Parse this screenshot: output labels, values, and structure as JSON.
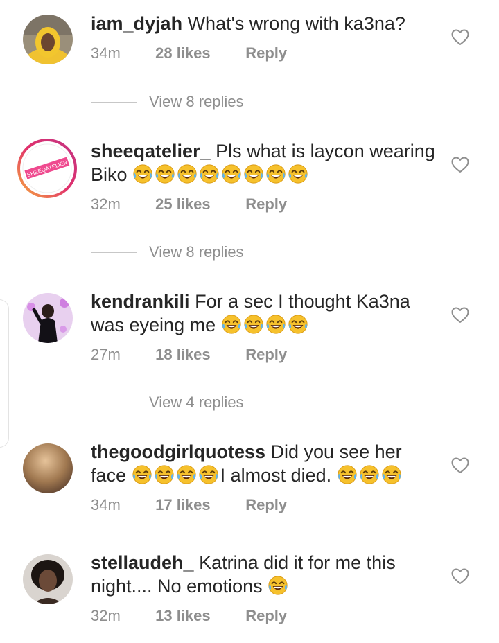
{
  "comments": [
    {
      "username": "iam_dyjah",
      "text": "What's wrong with ka3na?",
      "time": "34m",
      "likes": "28 likes",
      "reply": "Reply",
      "view_replies": "View 8 replies"
    },
    {
      "username": "sheeqatelier_",
      "text": "Pls what is laycon wearing Biko",
      "emoji_count": 8,
      "time": "32m",
      "likes": "25 likes",
      "reply": "Reply",
      "view_replies": "View 8 replies",
      "avatar_logo_text": "SHEEQATELIER"
    },
    {
      "username": "kendrankili",
      "text": "For a sec I thought Ka3na was eyeing me",
      "emoji_count": 4,
      "time": "27m",
      "likes": "18 likes",
      "reply": "Reply",
      "view_replies": "View 4 replies"
    },
    {
      "username": "thegoodgirlquotess",
      "text_a": "Did you see her face",
      "emoji_count_a": 4,
      "text_b": "I almost died.",
      "emoji_count_b": 3,
      "time": "34m",
      "likes": "17 likes",
      "reply": "Reply"
    },
    {
      "username": "stellaudeh_",
      "text": "Katrina did it for me this night.... No emotions",
      "emoji_count": 1,
      "time": "32m",
      "likes": "13 likes",
      "reply": "Reply"
    }
  ],
  "emoji_name": "face-with-tears-of-joy-icon",
  "icons": {
    "like": "heart-outline-icon"
  },
  "colors": {
    "text": "#262626",
    "meta": "#8e8e8e",
    "divider": "#c7c7c7",
    "emoji": "#f6c12c"
  }
}
